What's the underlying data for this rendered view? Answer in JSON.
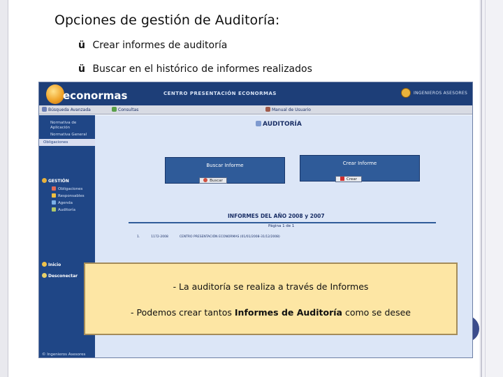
{
  "slide": {
    "title": "Opciones de gestión de Auditoría:",
    "bullets": [
      "Crear informes de auditoría",
      "Buscar en el histórico de informes realizados"
    ],
    "check_mark": "ü"
  },
  "app": {
    "logo_text": "econormas",
    "header_center": "CENTRO PRESENTACIÓN ECONORMAS",
    "header_brand": "INGENIEROS ASESORES",
    "nav": {
      "busqueda": "Búsqueda Avanzada",
      "consultas": "Consultas",
      "manual": "Manual de Usuario"
    },
    "sidebar": {
      "top_items": [
        "Normativa de Aplicación",
        "Normativa General"
      ],
      "active_item": "Obligaciones",
      "section_gestion": "GESTIÓN",
      "gestion_items": [
        "Obligaciones",
        "Responsables",
        "Agenda",
        "Auditoría"
      ],
      "section_inicio": "Inicio",
      "section_desconectar": "Desconectar",
      "footer": "© Ingenieros Asesores"
    },
    "main": {
      "title": "AUDITORÍA",
      "buscar_label": "Buscar Informe",
      "buscar_button": "Buscar",
      "crear_label": "Crear Informe",
      "crear_button": "Crear",
      "reports_title": "INFORMES DEL AÑO 2008 y 2007",
      "page_indicator": "Página 1 de 1",
      "row": {
        "index": "1.",
        "code": "1172-2008",
        "center": "CENTRO PRESENTACIÓN ECONORMAS (01/01/2008-31/12/2008)"
      }
    }
  },
  "note": {
    "line1": "- La auditoría se realiza a través de Informes",
    "line2_pre": "- Podemos crear tantos ",
    "line2_bold": "Informes de Auditoría",
    "line2_post": " como se desee"
  },
  "colors": {
    "app_blue": "#1f4686",
    "main_bg": "#dce6f7",
    "note_bg": "#fde6a4"
  }
}
